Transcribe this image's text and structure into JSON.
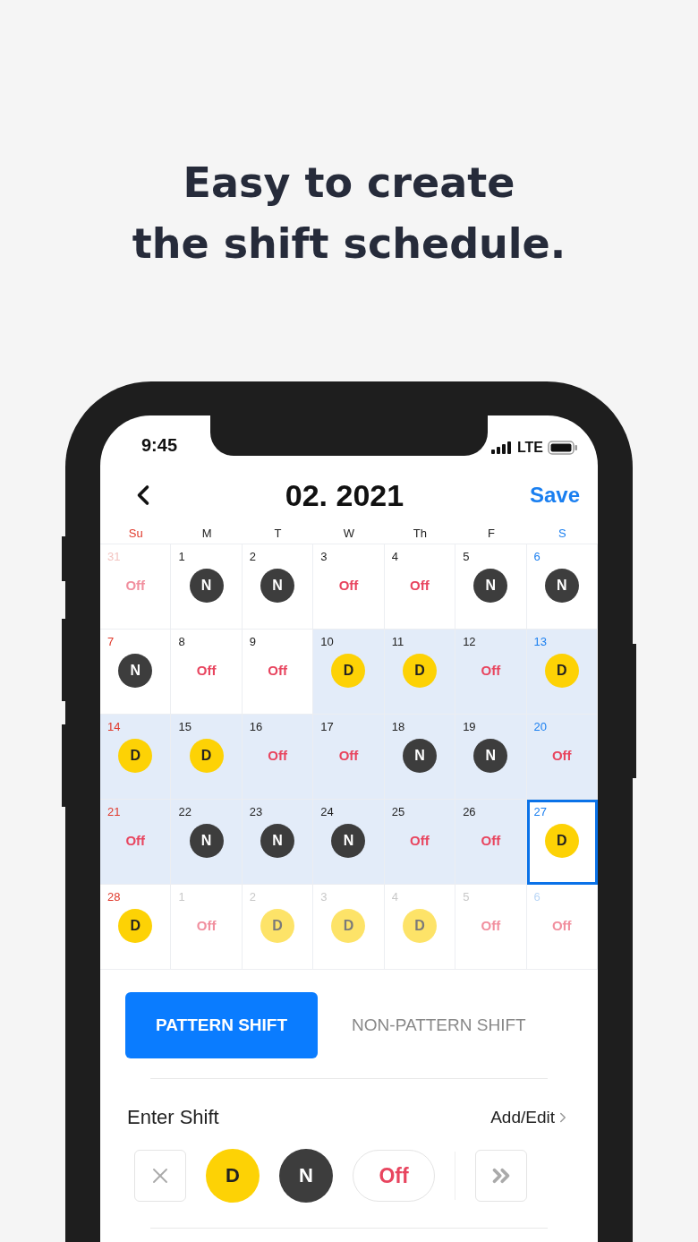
{
  "headline": [
    "Easy to create",
    "the shift schedule."
  ],
  "status_bar": {
    "time": "9:45",
    "network": "LTE"
  },
  "header": {
    "title": "02. 2021",
    "save": "Save"
  },
  "weekdays": [
    "Su",
    "M",
    "T",
    "W",
    "Th",
    "F",
    "S"
  ],
  "weeks": [
    [
      {
        "day": "31",
        "outside": true,
        "in_range": false,
        "selected": false,
        "shift": {
          "kind": "off",
          "label": "Off"
        }
      },
      {
        "day": "1",
        "outside": false,
        "in_range": false,
        "selected": false,
        "shift": {
          "kind": "night",
          "label": "N"
        }
      },
      {
        "day": "2",
        "outside": false,
        "in_range": false,
        "selected": false,
        "shift": {
          "kind": "night",
          "label": "N"
        }
      },
      {
        "day": "3",
        "outside": false,
        "in_range": false,
        "selected": false,
        "shift": {
          "kind": "off",
          "label": "Off"
        }
      },
      {
        "day": "4",
        "outside": false,
        "in_range": false,
        "selected": false,
        "shift": {
          "kind": "off",
          "label": "Off"
        }
      },
      {
        "day": "5",
        "outside": false,
        "in_range": false,
        "selected": false,
        "shift": {
          "kind": "night",
          "label": "N"
        }
      },
      {
        "day": "6",
        "outside": false,
        "in_range": false,
        "selected": false,
        "shift": {
          "kind": "night",
          "label": "N"
        }
      }
    ],
    [
      {
        "day": "7",
        "outside": false,
        "in_range": false,
        "selected": false,
        "shift": {
          "kind": "night",
          "label": "N"
        }
      },
      {
        "day": "8",
        "outside": false,
        "in_range": false,
        "selected": false,
        "shift": {
          "kind": "off",
          "label": "Off"
        }
      },
      {
        "day": "9",
        "outside": false,
        "in_range": false,
        "selected": false,
        "shift": {
          "kind": "off",
          "label": "Off"
        }
      },
      {
        "day": "10",
        "outside": false,
        "in_range": true,
        "selected": false,
        "shift": {
          "kind": "day",
          "label": "D"
        }
      },
      {
        "day": "11",
        "outside": false,
        "in_range": true,
        "selected": false,
        "shift": {
          "kind": "day",
          "label": "D"
        }
      },
      {
        "day": "12",
        "outside": false,
        "in_range": true,
        "selected": false,
        "shift": {
          "kind": "off",
          "label": "Off"
        }
      },
      {
        "day": "13",
        "outside": false,
        "in_range": true,
        "selected": false,
        "shift": {
          "kind": "day",
          "label": "D"
        }
      }
    ],
    [
      {
        "day": "14",
        "outside": false,
        "in_range": true,
        "selected": false,
        "shift": {
          "kind": "day",
          "label": "D"
        }
      },
      {
        "day": "15",
        "outside": false,
        "in_range": true,
        "selected": false,
        "shift": {
          "kind": "day",
          "label": "D"
        }
      },
      {
        "day": "16",
        "outside": false,
        "in_range": true,
        "selected": false,
        "shift": {
          "kind": "off",
          "label": "Off"
        }
      },
      {
        "day": "17",
        "outside": false,
        "in_range": true,
        "selected": false,
        "shift": {
          "kind": "off",
          "label": "Off"
        }
      },
      {
        "day": "18",
        "outside": false,
        "in_range": true,
        "selected": false,
        "shift": {
          "kind": "night",
          "label": "N"
        }
      },
      {
        "day": "19",
        "outside": false,
        "in_range": true,
        "selected": false,
        "shift": {
          "kind": "night",
          "label": "N"
        }
      },
      {
        "day": "20",
        "outside": false,
        "in_range": true,
        "selected": false,
        "shift": {
          "kind": "off",
          "label": "Off"
        }
      }
    ],
    [
      {
        "day": "21",
        "outside": false,
        "in_range": true,
        "selected": false,
        "shift": {
          "kind": "off",
          "label": "Off"
        }
      },
      {
        "day": "22",
        "outside": false,
        "in_range": true,
        "selected": false,
        "shift": {
          "kind": "night",
          "label": "N"
        }
      },
      {
        "day": "23",
        "outside": false,
        "in_range": true,
        "selected": false,
        "shift": {
          "kind": "night",
          "label": "N"
        }
      },
      {
        "day": "24",
        "outside": false,
        "in_range": true,
        "selected": false,
        "shift": {
          "kind": "night",
          "label": "N"
        }
      },
      {
        "day": "25",
        "outside": false,
        "in_range": true,
        "selected": false,
        "shift": {
          "kind": "off",
          "label": "Off"
        }
      },
      {
        "day": "26",
        "outside": false,
        "in_range": true,
        "selected": false,
        "shift": {
          "kind": "off",
          "label": "Off"
        }
      },
      {
        "day": "27",
        "outside": false,
        "in_range": false,
        "selected": true,
        "shift": {
          "kind": "day",
          "label": "D"
        }
      }
    ],
    [
      {
        "day": "28",
        "outside": false,
        "in_range": false,
        "selected": false,
        "shift": {
          "kind": "day",
          "label": "D"
        }
      },
      {
        "day": "1",
        "outside": true,
        "in_range": false,
        "selected": false,
        "shift": {
          "kind": "off",
          "label": "Off"
        }
      },
      {
        "day": "2",
        "outside": true,
        "in_range": false,
        "selected": false,
        "shift": {
          "kind": "day",
          "label": "D"
        }
      },
      {
        "day": "3",
        "outside": true,
        "in_range": false,
        "selected": false,
        "shift": {
          "kind": "day",
          "label": "D"
        }
      },
      {
        "day": "4",
        "outside": true,
        "in_range": false,
        "selected": false,
        "shift": {
          "kind": "day",
          "label": "D"
        }
      },
      {
        "day": "5",
        "outside": true,
        "in_range": false,
        "selected": false,
        "shift": {
          "kind": "off",
          "label": "Off"
        }
      },
      {
        "day": "6",
        "outside": true,
        "in_range": false,
        "selected": false,
        "shift": {
          "kind": "off",
          "label": "Off"
        }
      }
    ]
  ],
  "mode_tabs": [
    {
      "label": "PATTERN SHIFT",
      "selected": true
    },
    {
      "label": "NON-PATTERN SHIFT",
      "selected": false
    }
  ],
  "enter_shift": {
    "title": "Enter Shift",
    "link": "Add/Edit"
  },
  "shift_buttons": [
    {
      "kind": "clear"
    },
    {
      "kind": "day",
      "label": "D"
    },
    {
      "kind": "night",
      "label": "N"
    },
    {
      "kind": "off",
      "label": "Off"
    },
    {
      "kind": "more"
    }
  ]
}
